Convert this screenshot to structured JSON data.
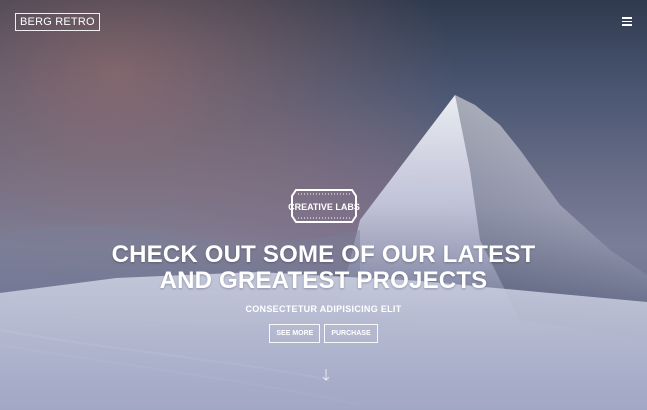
{
  "brand": {
    "name": "BERG RETRO"
  },
  "nav": {
    "menu_icon": "hamburger-icon"
  },
  "hero": {
    "badge_text": "CREATIVE LABS",
    "headline_line1": "CHECK OUT SOME OF OUR LATEST",
    "headline_line2": "AND GREATEST PROJECTS",
    "subheadline": "CONSECTETUR ADIPISICING ELIT",
    "buttons": {
      "see_more": "SEE MORE",
      "purchase": "PURCHASE"
    }
  },
  "colors": {
    "text": "#ffffff",
    "overlay_top": "#2f3a4e",
    "overlay_mid": "#6b6f89",
    "overlay_bottom": "#4f587a"
  }
}
